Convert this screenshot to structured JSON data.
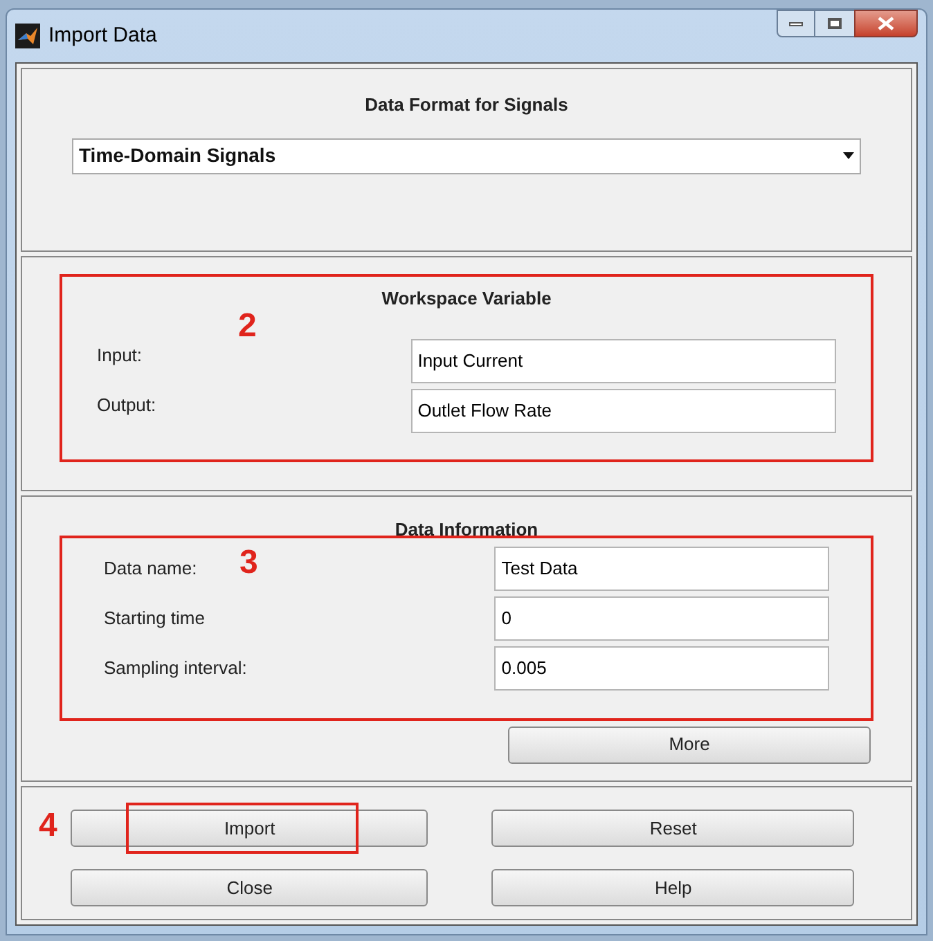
{
  "window": {
    "title": "Import Data"
  },
  "format_panel": {
    "title": "Data Format for Signals",
    "dropdown": {
      "value": "Time-Domain Signals"
    }
  },
  "workspace_panel": {
    "title": "Workspace Variable",
    "annotation": "2",
    "fields": [
      {
        "label": "Input:",
        "value": "Input Current"
      },
      {
        "label": "Output:",
        "value": "Outlet Flow Rate"
      }
    ]
  },
  "info_panel": {
    "title": "Data Information",
    "annotation": "3",
    "fields": [
      {
        "label": "Data name:",
        "value": "Test Data"
      },
      {
        "label": "Starting time",
        "value": "0"
      },
      {
        "label": "Sampling interval:",
        "value": "0.005"
      }
    ],
    "more_button": "More"
  },
  "buttons_panel": {
    "annotation": "4",
    "buttons": [
      {
        "label": "Import",
        "highlighted": true
      },
      {
        "label": "Reset",
        "highlighted": false
      },
      {
        "label": "Close",
        "highlighted": false
      },
      {
        "label": "Help",
        "highlighted": false
      }
    ]
  }
}
